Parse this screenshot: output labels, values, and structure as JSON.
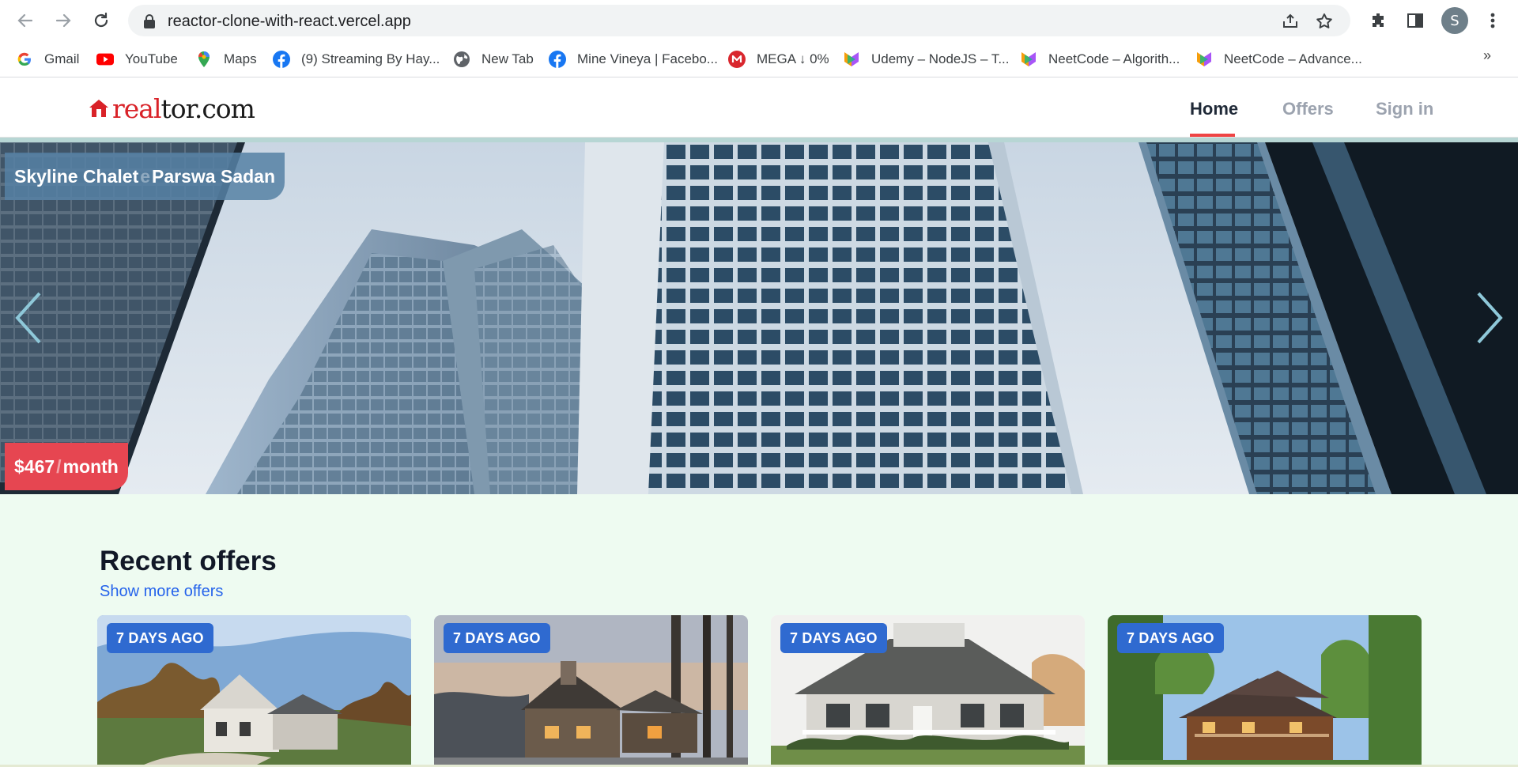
{
  "browser": {
    "url": "reactor-clone-with-react.vercel.app",
    "profile_initial": "S",
    "bookmarks": [
      {
        "label": "Gmail",
        "icon": "google-icon"
      },
      {
        "label": "YouTube",
        "icon": "youtube-icon"
      },
      {
        "label": "Maps",
        "icon": "maps-icon"
      },
      {
        "label": "(9) Streaming By Hay...",
        "icon": "facebook-icon"
      },
      {
        "label": "New Tab",
        "icon": "globe-icon"
      },
      {
        "label": "Mine Vineya | Facebo...",
        "icon": "facebook-icon"
      },
      {
        "label": "MEGA ↓ 0%",
        "icon": "mega-icon"
      },
      {
        "label": "Udemy – NodeJS – T...",
        "icon": "neetcode-icon"
      },
      {
        "label": "NeetCode – Algorith...",
        "icon": "neetcode-icon"
      },
      {
        "label": "NeetCode – Advance...",
        "icon": "neetcode-icon"
      }
    ],
    "more_bookmarks": "»"
  },
  "site": {
    "logo_red": "real",
    "logo_dark": "tor.com",
    "nav": {
      "home": "Home",
      "offers": "Offers",
      "signin": "Sign in"
    }
  },
  "hero": {
    "title": "Skyline Chalet",
    "title_ghost": "e",
    "title_next": "Parswa Sadan",
    "price": "$467",
    "price_ghost": "/",
    "price_suffix": "month",
    "prev_label": "‹",
    "next_label": "›"
  },
  "offers": {
    "heading": "Recent offers",
    "link": "Show more offers",
    "cards": [
      {
        "badge": "7 DAYS AGO"
      },
      {
        "badge": "7 DAYS AGO"
      },
      {
        "badge": "7 DAYS AGO"
      },
      {
        "badge": "7 DAYS AGO"
      }
    ]
  },
  "colors": {
    "brand_red": "#d92228",
    "nav_underline": "#ef4444",
    "badge_blue": "#2f6ad0",
    "price_red": "#e64651",
    "section_bg": "#eefbf1",
    "link_blue": "#2563eb"
  }
}
